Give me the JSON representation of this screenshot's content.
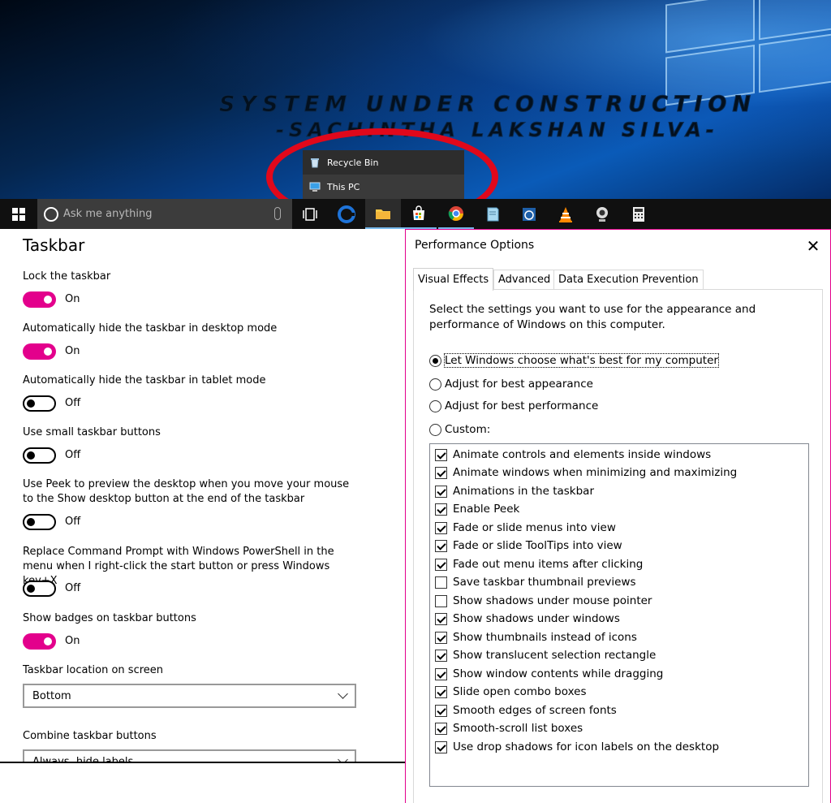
{
  "desktop": {
    "wallpaper_title": "SYSTEM UNDER CONSTRUCTION",
    "wallpaper_subtitle": "-SACHINTHA LAKSHAN SILVA-",
    "jump_list": [
      {
        "label": "Recycle Bin",
        "icon": "recycle-bin-icon"
      },
      {
        "label": "This PC",
        "icon": "computer-icon"
      }
    ],
    "annotation_color": "#e0081b"
  },
  "taskbar": {
    "search_placeholder": "Ask me anything",
    "apps": [
      "task-view",
      "edge",
      "file-explorer",
      "store",
      "chrome",
      "notepad",
      "xbox",
      "vlc",
      "webcam",
      "calculator"
    ]
  },
  "settings": {
    "title": "Taskbar",
    "items": [
      {
        "label": "Lock the taskbar",
        "state": "On"
      },
      {
        "label": "Automatically hide the taskbar in desktop mode",
        "state": "On"
      },
      {
        "label": "Automatically hide the taskbar in tablet mode",
        "state": "Off"
      },
      {
        "label": "Use small taskbar buttons",
        "state": "Off"
      },
      {
        "label": "Use Peek to preview the desktop when you move your mouse to the Show desktop button at the end of the taskbar",
        "state": "Off"
      },
      {
        "label": "Replace Command Prompt with Windows PowerShell in the menu when I right-click the start button or press Windows key+X",
        "state": "Off"
      },
      {
        "label": "Show badges on taskbar buttons",
        "state": "On"
      }
    ],
    "location_label": "Taskbar location on screen",
    "location_value": "Bottom",
    "combine_label": "Combine taskbar buttons",
    "combine_value": "Always, hide labels",
    "accent_color": "#e3008c"
  },
  "perf": {
    "title": "Performance Options",
    "close": "✕",
    "tabs": [
      "Visual Effects",
      "Advanced",
      "Data Execution Prevention"
    ],
    "description": "Select the settings you want to use for the appearance and performance of Windows on this computer.",
    "radios": [
      {
        "label": "Let Windows choose what's best for my computer",
        "checked": true
      },
      {
        "label": "Adjust for best appearance",
        "checked": false
      },
      {
        "label": "Adjust for best performance",
        "checked": false
      },
      {
        "label": "Custom:",
        "checked": false
      }
    ],
    "effects": [
      {
        "label": "Animate controls and elements inside windows",
        "checked": true
      },
      {
        "label": "Animate windows when minimizing and maximizing",
        "checked": true
      },
      {
        "label": "Animations in the taskbar",
        "checked": true
      },
      {
        "label": "Enable Peek",
        "checked": true
      },
      {
        "label": "Fade or slide menus into view",
        "checked": true
      },
      {
        "label": "Fade or slide ToolTips into view",
        "checked": true
      },
      {
        "label": "Fade out menu items after clicking",
        "checked": true
      },
      {
        "label": "Save taskbar thumbnail previews",
        "checked": false
      },
      {
        "label": "Show shadows under mouse pointer",
        "checked": false
      },
      {
        "label": "Show shadows under windows",
        "checked": true
      },
      {
        "label": "Show thumbnails instead of icons",
        "checked": true
      },
      {
        "label": "Show translucent selection rectangle",
        "checked": true
      },
      {
        "label": "Show window contents while dragging",
        "checked": true
      },
      {
        "label": "Slide open combo boxes",
        "checked": true
      },
      {
        "label": "Smooth edges of screen fonts",
        "checked": true
      },
      {
        "label": "Smooth-scroll list boxes",
        "checked": true
      },
      {
        "label": "Use drop shadows for icon labels on the desktop",
        "checked": true
      }
    ]
  }
}
